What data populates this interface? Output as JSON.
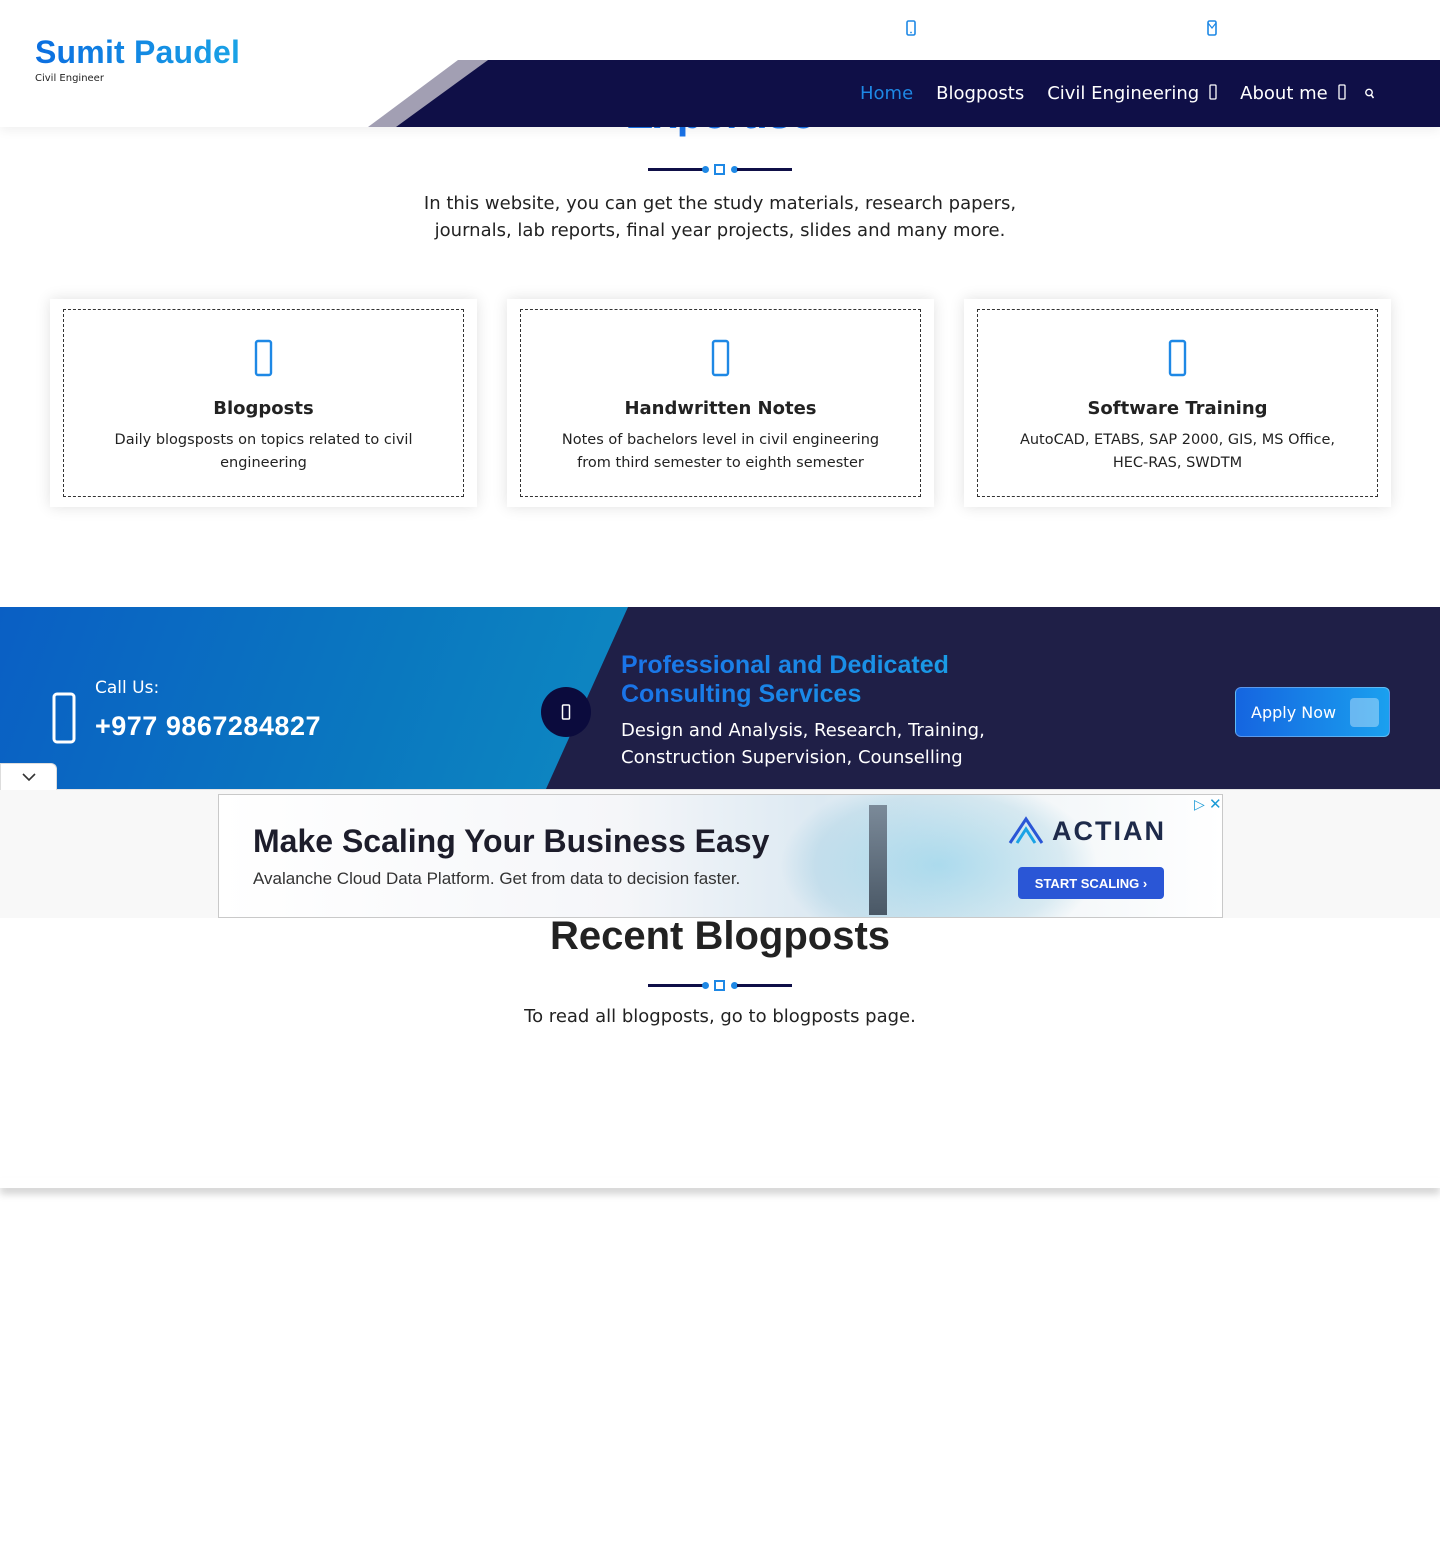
{
  "brand": {
    "name": "Sumit Paudel",
    "tagline": "Civil Engineer"
  },
  "topbar": {
    "icons": [
      "phone-icon",
      "envelope-icon"
    ]
  },
  "nav": {
    "items": [
      {
        "label": "Home",
        "active": true
      },
      {
        "label": "Blogposts",
        "active": false
      },
      {
        "label": "Civil Engineering",
        "active": false,
        "has_dropdown": true
      },
      {
        "label": "About me",
        "active": false,
        "has_dropdown": true
      }
    ],
    "search_icon": "search-icon"
  },
  "expertise": {
    "title": "Expertise",
    "lead": "In this website, you can get the study materials, research papers, journals, lab reports, final year projects, slides and many more.",
    "cards": [
      {
        "icon": "pencil-icon",
        "title": "Blogposts",
        "text": "Daily blogsposts on topics related to civil engineering"
      },
      {
        "icon": "book-icon",
        "title": "Handwritten Notes",
        "text": "Notes of bachelors level in civil engineering from third semester to eighth semester"
      },
      {
        "icon": "desktop-icon",
        "title": "Software Training",
        "text": "AutoCAD, ETABS, SAP 2000, GIS, MS Office, HEC-RAS, SWDTM"
      }
    ]
  },
  "banner": {
    "call_label": "Call Us:",
    "call_number": "+977 9867284827",
    "title": "Professional and Dedicated Consulting Services",
    "text": "Design and Analysis, Research, Training, Construction Supervision, Counselling",
    "apply_label": "Apply Now"
  },
  "ad": {
    "headline": "Make Scaling Your Business Easy",
    "sub": "Avalanche Cloud Data Platform. Get from data to decision faster.",
    "logo": "ACTIAN",
    "cta": "START SCALING"
  },
  "recent": {
    "title": "Recent Blogposts",
    "subtitle": "To read all blogposts, go to blogposts page."
  },
  "colors": {
    "accent": "#1a73e8",
    "navy": "#0f0f47",
    "banner_dark": "#1f1f47"
  }
}
